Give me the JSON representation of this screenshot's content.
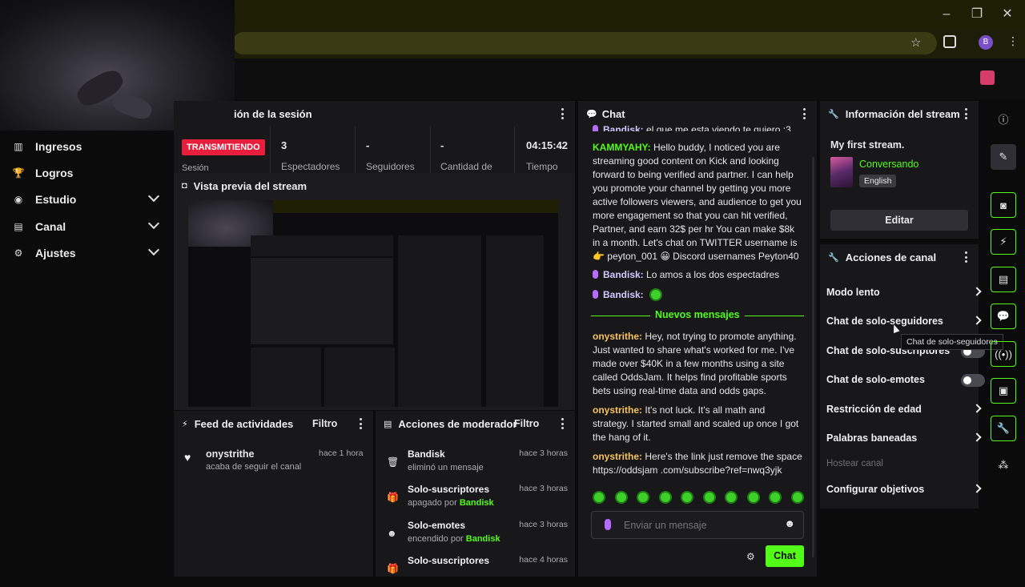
{
  "colors": {
    "accent": "#53fc18",
    "live": "#e91e3c",
    "panel": "#18181b",
    "purple": "#b56cff"
  },
  "browser": {
    "profile_initial": "B"
  },
  "sidebar": {
    "items": [
      {
        "label": "Ingresos",
        "icon": "chart-icon",
        "expandable": false
      },
      {
        "label": "Logros",
        "icon": "trophy-icon",
        "expandable": false
      },
      {
        "label": "Estudio",
        "icon": "studio-icon",
        "expandable": true
      },
      {
        "label": "Canal",
        "icon": "channel-icon",
        "expandable": true
      },
      {
        "label": "Ajustes",
        "icon": "gear-icon",
        "expandable": true
      }
    ]
  },
  "session": {
    "title": "ión de la sesión",
    "status": "TRANSMITIENDO",
    "status_label": "Sesión",
    "stats": [
      {
        "value": "3",
        "label": "Espectadores"
      },
      {
        "value": "-",
        "label": "Seguidores"
      },
      {
        "value": "-",
        "label": "Cantidad de"
      },
      {
        "value": "04:15:42",
        "label": "Tiempo"
      }
    ]
  },
  "preview": {
    "title": "Vista previa del stream"
  },
  "feed": {
    "title": "Feed de actividades",
    "filter": "Filtro",
    "items": [
      {
        "user": "onystrithe",
        "text": "acaba de seguir el canal",
        "time": "hace 1 hora"
      }
    ]
  },
  "mod": {
    "title": "Acciones de moderador",
    "filter": "Filtro",
    "items": [
      {
        "title": "Bandisk",
        "sub": "eliminó un mensaje",
        "by": "",
        "time": "hace 3 horas",
        "icon": "trash-icon"
      },
      {
        "title": "Solo-suscriptores",
        "sub": "apagado por ",
        "by": "Bandisk",
        "time": "hace 3 horas",
        "icon": "gift-icon"
      },
      {
        "title": "Solo-emotes",
        "sub": "encendido por ",
        "by": "Bandisk",
        "time": "hace 3 horas",
        "icon": "emoji-icon"
      },
      {
        "title": "Solo-suscriptores",
        "sub": "",
        "by": "",
        "time": "hace 4 horas",
        "icon": "gift-icon"
      }
    ]
  },
  "chat": {
    "title": "Chat",
    "new_messages": "Nuevos mensajes",
    "placeholder": "Enviar un mensaje",
    "send": "Chat",
    "top_partial": {
      "user": "Bandisk:",
      "text": "el que me esta viendo te quiero :3"
    },
    "messages": [
      {
        "user": "KAMMYAHY:",
        "text": "Hello buddy, I noticed you are streaming good content on Kick and looking forward to being verified and partner. I can help you promote your channel by getting you more active followers viewers, and audience to get you more engagement so that you can hit verified, Partner, and earn 32$ per hr You can make $8k in a month. Let's chat on TWITTER username is 👉 peyton_001 😀 Discord usernames Peyton40"
      },
      {
        "user": "Bandisk:",
        "text": "Lo amos a los dos espectadres",
        "mic": true
      },
      {
        "user": "Bandisk:",
        "text": "",
        "mic": true,
        "emote": true
      }
    ],
    "new": [
      {
        "user": "onystrithe:",
        "text": "Hey, not trying to promote anything. Just wanted to share what's worked for me. I've made over $40K in a few months using a site called OddsJam. It helps find profitable sports bets using real-time data and odds gaps."
      },
      {
        "user": "onystrithe:",
        "text": "It's not luck. It's all math and strategy. I started small and scaled up once I got the hang of it."
      },
      {
        "user": "onystrithe:",
        "text": "Here's the link just remove the space https://oddsjam .com/subscribe?ref=nwq3yjk"
      }
    ]
  },
  "info": {
    "title": "Información del stream",
    "stream_title": "My first stream.",
    "category": "Conversando",
    "language": "English",
    "edit": "Editar"
  },
  "actions": {
    "title": "Acciones de canal",
    "items": [
      {
        "label": "Modo lento",
        "type": "arrow"
      },
      {
        "label": "Chat de solo-seguidores",
        "type": "arrow"
      },
      {
        "label": "Chat de solo-suscriptores",
        "type": "toggle"
      },
      {
        "label": "Chat de solo-emotes",
        "type": "toggle"
      },
      {
        "label": "Restricción de edad",
        "type": "arrow"
      },
      {
        "label": "Palabras baneadas",
        "type": "arrow"
      },
      {
        "label": "Hostear canal",
        "type": "disabled"
      },
      {
        "label": "Configurar objetivos",
        "type": "arrow"
      }
    ],
    "tooltip": "Chat de solo-seguidores"
  }
}
